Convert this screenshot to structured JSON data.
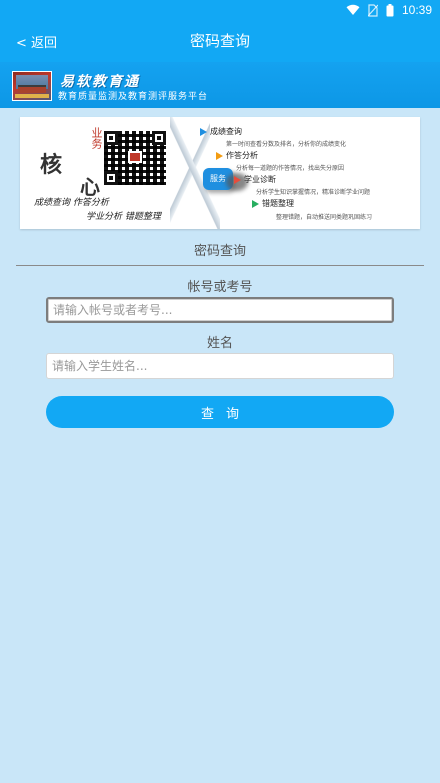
{
  "status_bar": {
    "time": "10:39",
    "icons": [
      "wifi-icon",
      "no-sim-icon",
      "battery-icon"
    ]
  },
  "nav": {
    "back_label": "< 返回",
    "title": "密码查询"
  },
  "brand": {
    "name": "易软教育通",
    "slogan": "教育质量监测及教育测评服务平台"
  },
  "banner": {
    "vertical_text": "业务",
    "big_char_1": "核",
    "big_char_2": "心",
    "line_1": "成绩查询  作答分析",
    "line_2": "学业分析  错题整理",
    "service_label": "服务",
    "features": [
      {
        "title": "成绩查询",
        "desc": "第一时间查看分数及排名，分析你的成绩变化"
      },
      {
        "title": "作答分析",
        "desc": "分析每一道题的作答情况，找出失分原因"
      },
      {
        "title": "学业诊断",
        "desc": "分析学生知识掌握情况，精准诊断学业问题"
      },
      {
        "title": "错题整理",
        "desc": "整理错题，自动推送同类题巩固练习"
      }
    ]
  },
  "form": {
    "section_title": "密码查询",
    "account_label": "帐号或考号",
    "account_placeholder": "请输入帐号或者考号...",
    "account_value": "",
    "name_label": "姓名",
    "name_placeholder": "请输入学生姓名...",
    "name_value": "",
    "submit_label": "查询"
  },
  "colors": {
    "primary": "#12a8f4",
    "background": "#c9e6f8",
    "text": "#555555"
  }
}
